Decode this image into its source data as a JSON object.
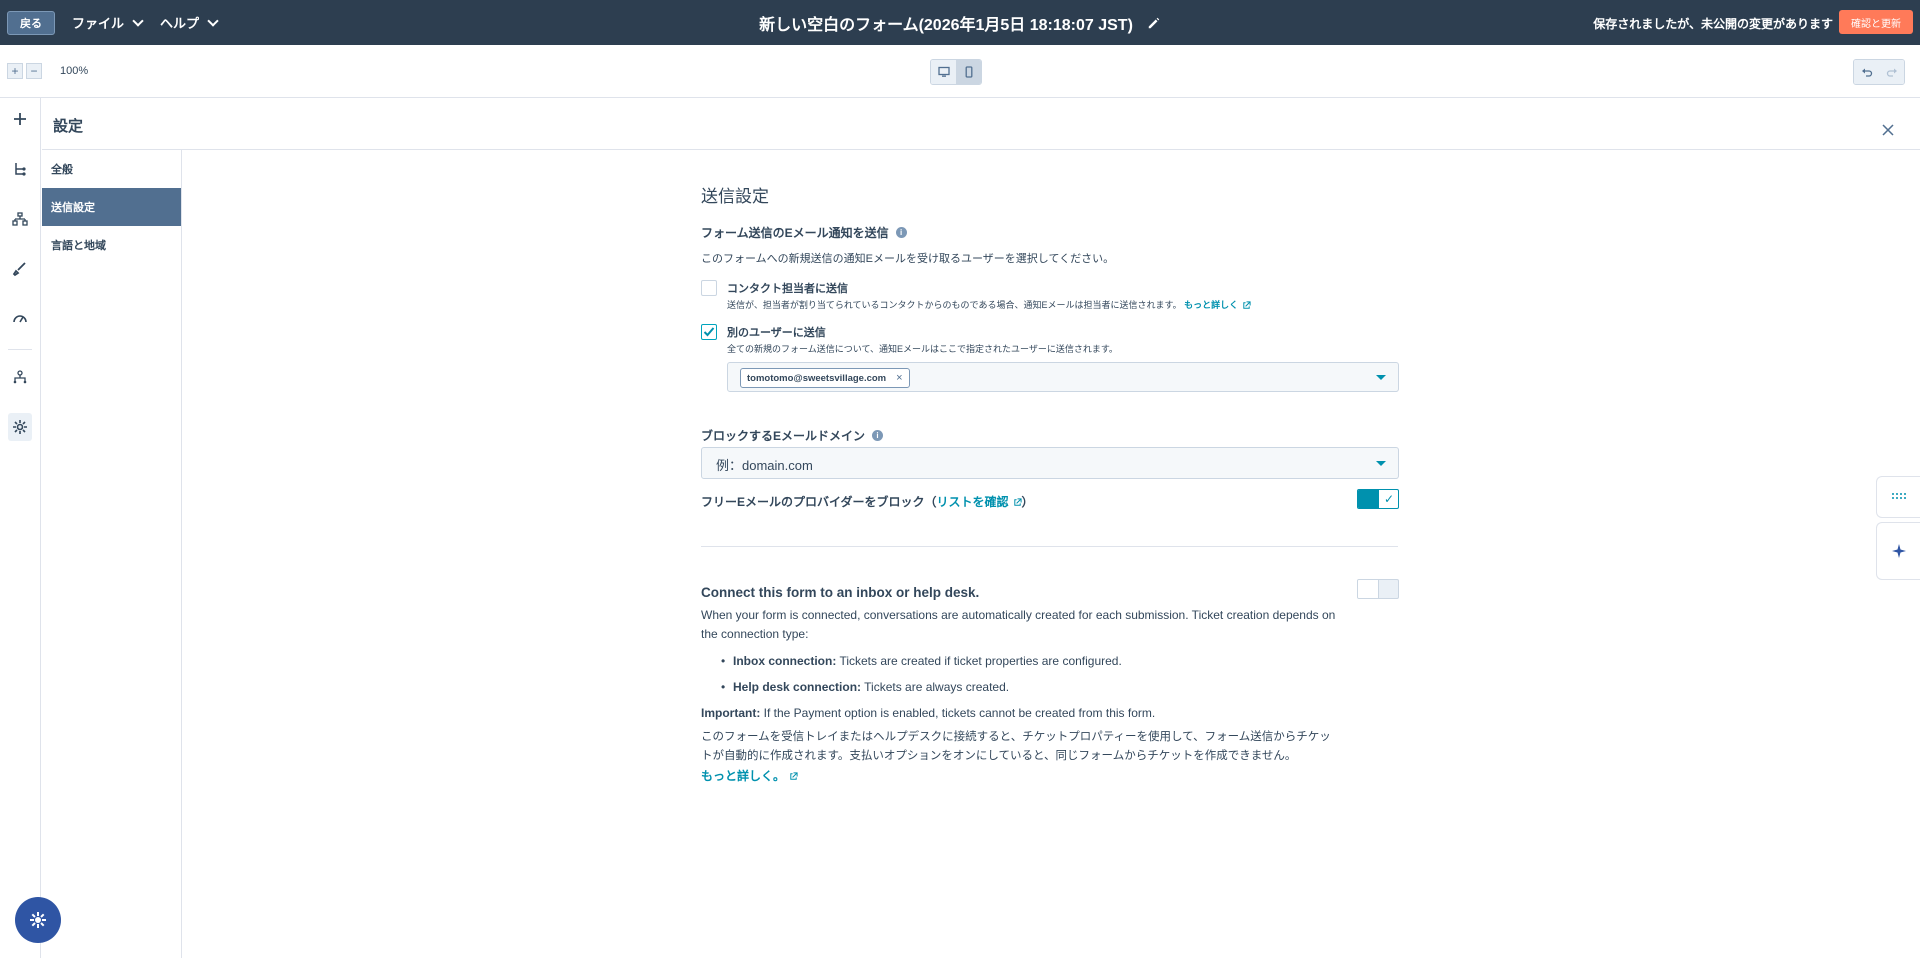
{
  "topbar": {
    "back_label": "戻る",
    "file_menu": "ファイル",
    "help_menu": "ヘルプ",
    "title": "新しい空白のフォーム(2026年1月5日 18:18:07 JST)",
    "save_status": "保存されましたが、未公開の変更があります",
    "publish_label": "確認と更新"
  },
  "toolbar": {
    "zoom_in": "+",
    "zoom_out": "−",
    "zoom_level": "100%"
  },
  "panel": {
    "title": "設定"
  },
  "settings_nav": {
    "items": [
      {
        "label": "全般"
      },
      {
        "label": "送信設定"
      },
      {
        "label": "言語と地域"
      }
    ]
  },
  "content": {
    "section_title": "送信設定",
    "notify": {
      "heading": "フォーム送信のEメール通知を送信",
      "description": "このフォームへの新規送信の通知Eメールを受け取るユーザーを選択してください。",
      "contact_owner_label": "コンタクト担当者に送信",
      "contact_owner_help": "送信が、担当者が割り当てられているコンタクトからのものである場合、通知Eメールは担当者に送信されます。",
      "contact_owner_link": "もっと詳しく",
      "other_users_label": "別のユーザーに送信",
      "other_users_help": "全ての新規のフォーム送信について、通知Eメールはここで指定されたユーザーに送信されます。",
      "selected_user": "tomotomo@sweetsvillage.com",
      "tag_remove": "×"
    },
    "block": {
      "heading": "ブロックするEメールドメイン",
      "placeholder": "例：domain.com",
      "free_label_prefix": "フリーEメールのプロバイダーをブロック（",
      "free_link": "リストを確認",
      "free_label_suffix": "）",
      "free_enabled": true
    },
    "connect": {
      "heading": "Connect this form to an inbox or help desk.",
      "enabled": false,
      "intro": "When your form is connected, conversations are automatically created for each submission. Ticket creation depends on the connection type:",
      "bullets": [
        {
          "term": "Inbox connection:",
          "text": " Tickets are created if ticket properties are configured."
        },
        {
          "term": "Help desk connection:",
          "text": " Tickets are always created."
        }
      ],
      "important_term": "Important:",
      "important_text": " If the Payment option is enabled, tickets cannot be created from this form.",
      "ja_text": "このフォームを受信トレイまたはヘルプデスクに接続すると、チケットプロパティーを使用して、フォーム送信からチケットが自動的に作成されます。支払いオプションをオンにしていると、同じフォームからチケットを作成できません。",
      "learn_more": "もっと詳しく。"
    }
  },
  "colors": {
    "topbar": "#2d3e50",
    "accent": "#0091ae",
    "publish": "#ff7a59",
    "nav_active": "#516f90"
  }
}
